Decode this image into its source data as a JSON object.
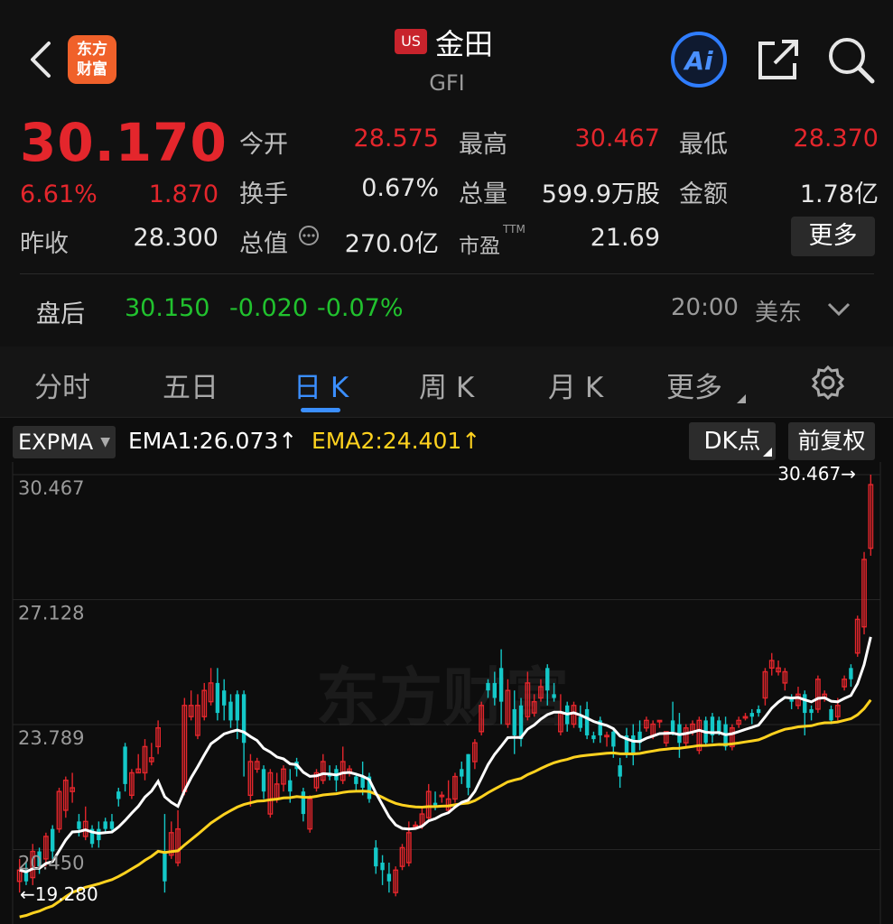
{
  "header": {
    "logo_line1": "东方",
    "logo_line2": "财富",
    "market_badge": "US",
    "stock_name": "金田",
    "stock_code": "GFI",
    "ai_label": "Ai"
  },
  "quote": {
    "price": "30.170",
    "change_pct": "6.61%",
    "change_abs": "1.870",
    "prev_close_label": "昨收",
    "prev_close": "28.300",
    "open_label": "今开",
    "open": "28.575",
    "turnover_label": "换手",
    "turnover": "0.67%",
    "mktcap_label": "总值",
    "mktcap": "270.0亿",
    "high_label": "最高",
    "high": "30.467",
    "volume_label": "总量",
    "volume": "599.9万股",
    "pe_label": "市盈",
    "pe_sup": "TTM",
    "pe": "21.69",
    "low_label": "最低",
    "low": "28.370",
    "amount_label": "金额",
    "amount": "1.78亿",
    "more_label": "更多"
  },
  "after_hours": {
    "label": "盘后",
    "price": "30.150",
    "change": "-0.020",
    "change_pct": "-0.07%",
    "time": "20:00",
    "zone": "美东"
  },
  "tabs": [
    {
      "label": "分时",
      "active": false
    },
    {
      "label": "五日",
      "active": false
    },
    {
      "label": "日 K",
      "active": true
    },
    {
      "label": "周 K",
      "active": false
    },
    {
      "label": "月 K",
      "active": false
    },
    {
      "label": "更多",
      "active": false
    }
  ],
  "indicator": {
    "selector": "EXPMA",
    "ema1": "EMA1:26.073↑",
    "ema2": "EMA2:24.401↑",
    "dk_label": "DK点",
    "adjust_label": "前复权"
  },
  "colors": {
    "up": "#e4262c",
    "down": "#14c8c8",
    "ema1": "#ffffff",
    "ema2": "#ffd21f",
    "after_hours": "#21c22e"
  },
  "chart_data": {
    "type": "candlestick",
    "y_ticks": [
      "30.467",
      "27.128",
      "23.789",
      "20.450"
    ],
    "ylim": [
      19.28,
      30.467
    ],
    "max_label": "30.467→",
    "min_label": "←19.280",
    "watermark": "东方财富",
    "candles": [
      [
        19.6,
        19.9,
        19.3,
        20.2
      ],
      [
        19.9,
        19.6,
        19.5,
        20.1
      ],
      [
        19.7,
        20.4,
        19.5,
        20.6
      ],
      [
        20.4,
        20.0,
        19.8,
        20.5
      ],
      [
        20.2,
        20.8,
        20.0,
        20.9
      ],
      [
        21.0,
        20.4,
        20.2,
        21.1
      ],
      [
        21.0,
        22.0,
        20.9,
        22.1
      ],
      [
        21.5,
        22.3,
        21.3,
        22.4
      ],
      [
        22.0,
        22.1,
        21.7,
        22.5
      ],
      [
        21.2,
        21.0,
        20.8,
        21.4
      ],
      [
        20.8,
        21.2,
        20.7,
        21.6
      ],
      [
        21.0,
        20.6,
        20.5,
        21.1
      ],
      [
        21.0,
        20.7,
        20.5,
        21.2
      ],
      [
        21.2,
        21.0,
        20.9,
        21.3
      ],
      [
        21.2,
        21.0,
        20.9,
        21.4
      ],
      [
        22.0,
        21.8,
        21.6,
        22.1
      ],
      [
        23.2,
        22.2,
        22.0,
        23.3
      ],
      [
        21.9,
        22.5,
        21.8,
        22.6
      ],
      [
        22.5,
        22.6,
        22.5,
        23.0
      ],
      [
        22.5,
        23.2,
        22.3,
        23.4
      ],
      [
        22.8,
        22.9,
        22.7,
        23.3
      ],
      [
        23.2,
        23.7,
        23.0,
        23.9
      ],
      [
        20.4,
        19.6,
        19.3,
        21.4
      ],
      [
        20.3,
        20.9,
        20.2,
        21.2
      ],
      [
        20.1,
        21.0,
        20.0,
        21.5
      ],
      [
        22.0,
        24.3,
        21.9,
        24.5
      ],
      [
        24.0,
        24.3,
        23.9,
        24.7
      ],
      [
        23.5,
        24.3,
        23.4,
        24.6
      ],
      [
        24.0,
        24.7,
        23.9,
        24.9
      ],
      [
        24.4,
        24.9,
        24.3,
        25.3
      ],
      [
        24.9,
        24.1,
        23.9,
        25.3
      ],
      [
        24.7,
        24.3,
        23.9,
        25.0
      ],
      [
        24.4,
        23.9,
        23.7,
        24.6
      ],
      [
        24.6,
        23.9,
        23.4,
        24.7
      ],
      [
        24.6,
        23.3,
        22.4,
        24.7
      ],
      [
        21.9,
        22.8,
        21.6,
        23.0
      ],
      [
        22.6,
        22.8,
        22.5,
        22.9
      ],
      [
        22.6,
        22.0,
        21.8,
        22.7
      ],
      [
        21.4,
        22.5,
        21.3,
        22.6
      ],
      [
        21.8,
        22.2,
        21.7,
        22.5
      ],
      [
        22.2,
        22.6,
        22.0,
        22.7
      ],
      [
        22.3,
        22.0,
        21.7,
        22.6
      ],
      [
        22.8,
        22.6,
        22.4,
        22.9
      ],
      [
        22.0,
        21.4,
        21.2,
        22.1
      ],
      [
        21.0,
        21.8,
        20.9,
        21.9
      ],
      [
        22.1,
        22.5,
        22.0,
        22.6
      ],
      [
        22.3,
        22.8,
        22.2,
        23.0
      ],
      [
        22.5,
        22.4,
        22.3,
        22.7
      ],
      [
        22.6,
        22.3,
        22.0,
        22.7
      ],
      [
        22.3,
        22.8,
        22.2,
        23.2
      ],
      [
        22.5,
        22.6,
        22.4,
        22.7
      ],
      [
        22.4,
        22.2,
        22.0,
        22.5
      ],
      [
        22.4,
        22.1,
        21.9,
        22.8
      ],
      [
        22.4,
        21.8,
        21.7,
        22.5
      ],
      [
        20.5,
        20.0,
        19.8,
        20.7
      ],
      [
        20.1,
        19.9,
        19.5,
        20.3
      ],
      [
        19.8,
        19.6,
        19.3,
        20.1
      ],
      [
        19.3,
        19.9,
        19.2,
        20.0
      ],
      [
        20.0,
        20.5,
        19.9,
        20.6
      ],
      [
        20.1,
        20.9,
        20.0,
        21.2
      ],
      [
        21.1,
        21.1,
        21.0,
        21.2
      ],
      [
        21.1,
        21.4,
        21.0,
        21.6
      ],
      [
        21.3,
        22.0,
        21.2,
        22.2
      ],
      [
        21.7,
        21.6,
        21.5,
        22.0
      ],
      [
        21.9,
        21.9,
        21.7,
        22.0
      ],
      [
        21.5,
        21.8,
        21.4,
        22.3
      ],
      [
        21.8,
        22.4,
        21.7,
        22.5
      ],
      [
        22.6,
        22.4,
        22.2,
        22.8
      ],
      [
        23.0,
        22.1,
        21.9,
        23.0
      ],
      [
        22.8,
        23.3,
        22.6,
        23.4
      ],
      [
        23.6,
        24.3,
        23.5,
        24.4
      ],
      [
        24.9,
        24.7,
        24.5,
        25.0
      ],
      [
        24.9,
        24.5,
        24.3,
        25.2
      ],
      [
        25.3,
        24.4,
        23.8,
        25.8
      ],
      [
        23.8,
        24.7,
        23.7,
        25.0
      ],
      [
        24.2,
        23.5,
        23.0,
        24.7
      ],
      [
        24.3,
        23.4,
        23.2,
        24.5
      ],
      [
        24.0,
        24.9,
        23.9,
        25.2
      ],
      [
        24.1,
        24.4,
        24.0,
        24.6
      ],
      [
        24.5,
        24.8,
        24.4,
        25.0
      ],
      [
        25.3,
        24.7,
        24.3,
        25.4
      ],
      [
        24.6,
        24.5,
        24.4,
        24.9
      ],
      [
        23.6,
        24.1,
        23.5,
        24.6
      ],
      [
        24.3,
        23.8,
        23.6,
        24.4
      ],
      [
        23.8,
        24.3,
        23.7,
        24.4
      ],
      [
        24.0,
        23.7,
        23.6,
        24.3
      ],
      [
        24.2,
        23.5,
        23.4,
        24.4
      ],
      [
        23.5,
        23.4,
        23.3,
        23.6
      ],
      [
        23.9,
        23.5,
        23.3,
        24.0
      ],
      [
        23.5,
        23.5,
        23.2,
        23.6
      ],
      [
        23.6,
        23.2,
        22.9,
        23.7
      ],
      [
        22.7,
        22.4,
        22.1,
        22.9
      ],
      [
        23.5,
        23.0,
        22.9,
        23.7
      ],
      [
        23.5,
        23.0,
        22.7,
        23.8
      ],
      [
        23.6,
        23.3,
        23.1,
        23.9
      ],
      [
        23.7,
        23.9,
        23.6,
        24.0
      ],
      [
        23.5,
        23.8,
        23.4,
        23.9
      ],
      [
        23.9,
        23.9,
        23.7,
        23.9
      ],
      [
        23.3,
        23.6,
        23.2,
        23.6
      ],
      [
        23.9,
        23.6,
        23.5,
        24.4
      ],
      [
        23.8,
        23.3,
        22.9,
        24.1
      ],
      [
        23.3,
        23.7,
        23.2,
        23.8
      ],
      [
        23.6,
        23.8,
        23.5,
        23.9
      ],
      [
        23.1,
        23.9,
        23.0,
        24.0
      ],
      [
        23.9,
        23.3,
        23.2,
        24.0
      ],
      [
        24.0,
        23.5,
        23.3,
        24.1
      ],
      [
        23.9,
        23.6,
        23.5,
        24.0
      ],
      [
        23.8,
        23.2,
        23.1,
        24.0
      ],
      [
        23.2,
        23.7,
        23.1,
        23.8
      ],
      [
        23.8,
        23.9,
        23.7,
        24.0
      ],
      [
        24.0,
        24.0,
        23.9,
        24.1
      ],
      [
        24.1,
        24.0,
        23.8,
        24.2
      ],
      [
        24.2,
        24.1,
        24.0,
        24.3
      ],
      [
        24.5,
        25.2,
        24.3,
        25.3
      ],
      [
        25.3,
        25.5,
        25.1,
        25.7
      ],
      [
        25.2,
        25.3,
        25.1,
        25.5
      ],
      [
        24.9,
        25.2,
        24.7,
        25.3
      ],
      [
        24.5,
        24.4,
        24.2,
        24.6
      ],
      [
        24.3,
        24.6,
        24.2,
        24.8
      ],
      [
        24.6,
        24.1,
        23.5,
        24.7
      ],
      [
        24.2,
        24.1,
        23.9,
        24.3
      ],
      [
        24.2,
        25.0,
        24.1,
        25.1
      ],
      [
        24.5,
        24.6,
        24.4,
        24.7
      ],
      [
        24.2,
        23.9,
        23.8,
        24.3
      ],
      [
        24.0,
        24.3,
        23.9,
        24.5
      ],
      [
        24.8,
        25.0,
        24.7,
        25.1
      ],
      [
        25.3,
        25.0,
        24.8,
        25.4
      ],
      [
        25.7,
        26.6,
        25.6,
        26.7
      ],
      [
        26.4,
        28.2,
        26.2,
        28.4
      ],
      [
        28.5,
        30.2,
        28.3,
        30.467
      ]
    ]
  }
}
